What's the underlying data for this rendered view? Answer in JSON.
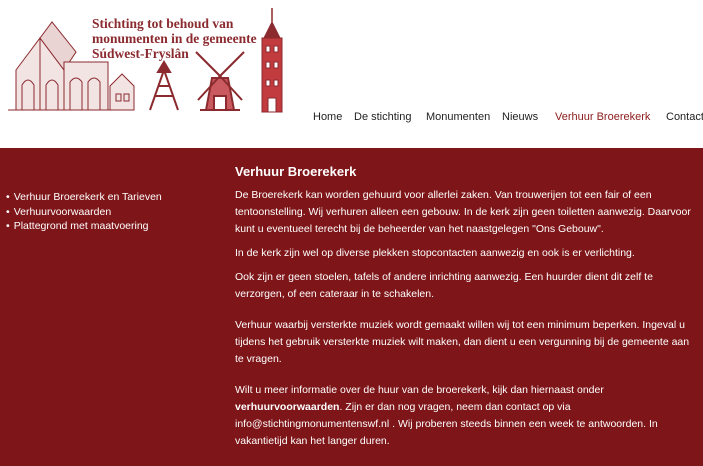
{
  "logo": {
    "line1": "Stichting tot behoud van",
    "line2": "monumenten in de gemeente",
    "line3": "Súdwest-Fryslân"
  },
  "nav": {
    "items": [
      "Home",
      "De stichting",
      "Monumenten",
      "Nieuws",
      "Verhuur Broerekerk",
      "Contact"
    ],
    "active": "Verhuur Broerekerk"
  },
  "sidebar": {
    "items": [
      "Verhuur Broerekerk en Tarieven",
      "Verhuurvoorwaarden",
      "Plattegrond met maatvoering"
    ]
  },
  "content": {
    "title": "Verhuur Broerekerk",
    "p1": "De Broerekerk kan worden gehuurd voor allerlei zaken. Van trouwerijen tot een fair of een tentoonstelling. Wij verhuren alleen een gebouw. In de kerk zijn geen toiletten aanwezig. Daarvoor kunt u eventueel terecht bij de beheerder van het naastgelegen \"Ons Gebouw\".",
    "p2": "In de kerk zijn wel op diverse plekken stopcontacten aanwezig en ook is er verlichting.",
    "p3": "Ook zijn er geen stoelen, tafels of andere inrichting aanwezig. Een huurder dient dit zelf te verzorgen, of een cateraar in te schakelen.",
    "p4": "Verhuur waarbij versterkte muziek wordt gemaakt willen wij tot een minimum beperken. Ingeval u tijdens het gebruik versterkte muziek wilt maken, dan dient u een vergunning bij de gemeente aan te vragen.",
    "p5_a": "Wilt u meer informatie over de huur van de broerekerk, kijk dan hiernaast onder",
    "p5_bold": "verhuurvoorwaarden",
    "p5_b": ". Zijn er dan nog vragen, neem dan contact op via info@stichtingmonumentenswf.nl . Wij proberen steeds binnen een week te antwoorden. In vakantietijd kan het langer duren."
  },
  "colors": {
    "brand_red": "#7e1518",
    "logo_red": "#8b2a2f",
    "nav_active": "#8b1a1a"
  }
}
